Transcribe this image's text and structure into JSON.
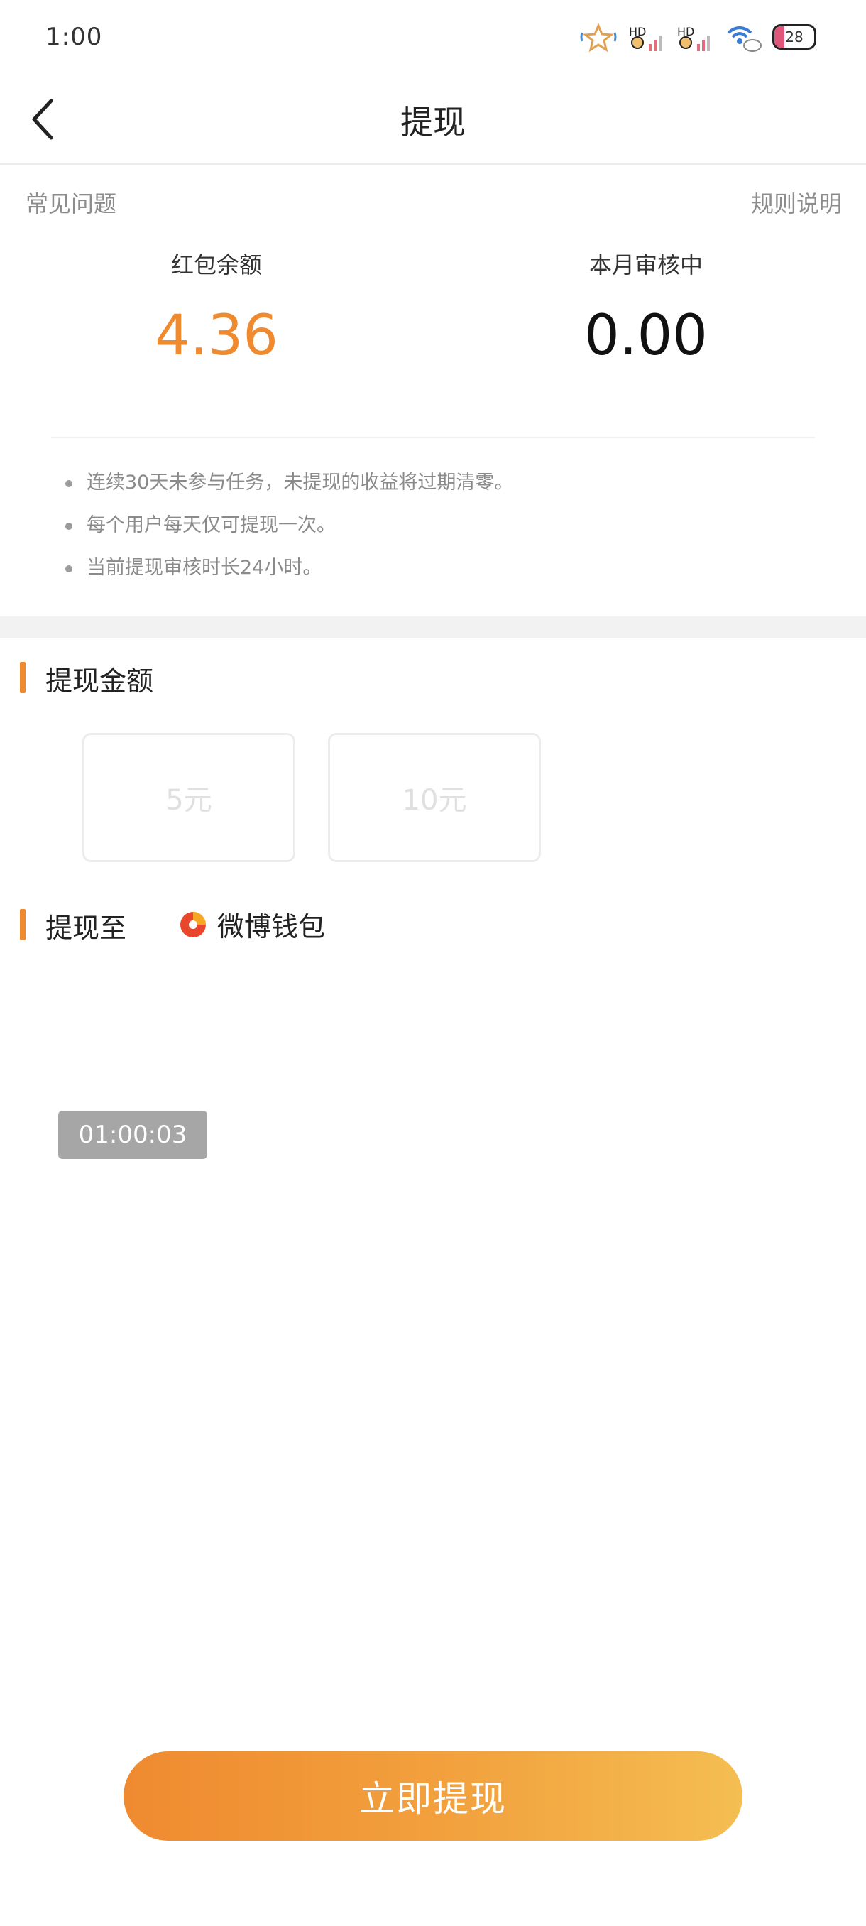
{
  "status_bar": {
    "time": "1:00",
    "battery": "28"
  },
  "header": {
    "title": "提现",
    "back_icon": "chevron-left-icon"
  },
  "links": {
    "faq": "常见问题",
    "rules": "规则说明"
  },
  "stats": {
    "balance": {
      "label": "红包余额",
      "value": "4.36"
    },
    "pending": {
      "label": "本月审核中",
      "value": "0.00"
    }
  },
  "rules": [
    "连续30天未参与任务，未提现的收益将过期清零。",
    "每个用户每天仅可提现一次。",
    "当前提现审核时长24小时。"
  ],
  "withdraw_amount": {
    "title": "提现金额",
    "options": [
      "5元",
      "10元"
    ]
  },
  "withdraw_to": {
    "title": "提现至",
    "wallet": "微博钱包",
    "wallet_icon": "weibo-wallet-icon"
  },
  "timer": "01:00:03",
  "withdraw_button": "立即提现",
  "colors": {
    "accent": "#ef8a2e",
    "button_gradient_start": "#ef8a30",
    "button_gradient_end": "#f4be52"
  }
}
